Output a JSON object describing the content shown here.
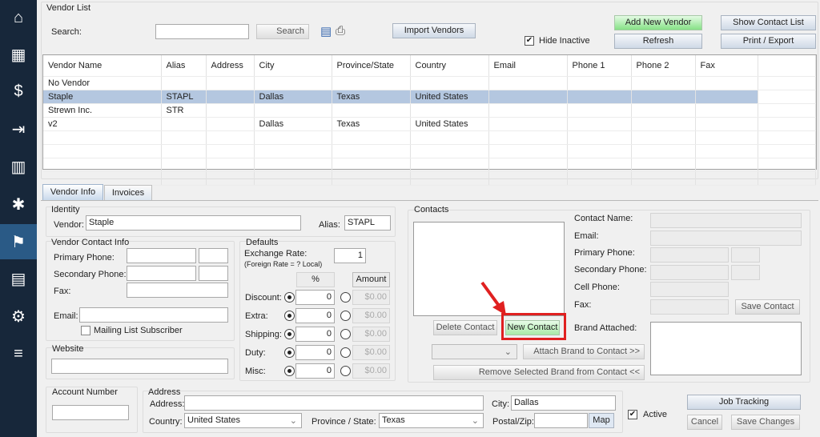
{
  "sidebar": {
    "items": [
      {
        "name": "home",
        "icon": "⌂"
      },
      {
        "name": "register",
        "icon": "▦"
      },
      {
        "name": "invoice",
        "icon": "$"
      },
      {
        "name": "logout",
        "icon": "⇥"
      },
      {
        "name": "buildings",
        "icon": "▥"
      },
      {
        "name": "person-walk",
        "icon": "✱"
      },
      {
        "name": "vendors",
        "icon": "⚑",
        "active": true
      },
      {
        "name": "reports",
        "icon": "▤"
      },
      {
        "name": "settings",
        "icon": "⚙"
      },
      {
        "name": "menu",
        "icon": "≡"
      }
    ]
  },
  "vendor_list": {
    "title": "Vendor List",
    "search_label": "Search:",
    "search_value": "",
    "search_button": "Search",
    "import_button": "Import Vendors",
    "hide_inactive_label": "Hide Inactive",
    "hide_inactive": true,
    "add_new_vendor": "Add New Vendor",
    "refresh": "Refresh",
    "show_contact_list": "Show Contact List",
    "print_export": "Print / Export",
    "columns": [
      "Vendor Name",
      "Alias",
      "Address",
      "City",
      "Province/State",
      "Country",
      "Email",
      "Phone 1",
      "Phone 2",
      "Fax"
    ],
    "rows": [
      [
        "No Vendor",
        "",
        "",
        "",
        "",
        "",
        "",
        "",
        "",
        ""
      ],
      [
        "Staple",
        "STAPL",
        "",
        "Dallas",
        "Texas",
        "United States",
        "",
        "",
        "",
        ""
      ],
      [
        "Strewn Inc.",
        "STR",
        "",
        "",
        "",
        "",
        "",
        "",
        "",
        ""
      ],
      [
        "v2",
        "",
        "",
        "Dallas",
        "Texas",
        "United States",
        "",
        "",
        "",
        ""
      ]
    ],
    "selected_row": 1
  },
  "tabs": [
    {
      "label": "Vendor Info",
      "active": true
    },
    {
      "label": "Invoices"
    }
  ],
  "identity": {
    "title": "Identity",
    "vendor_label": "Vendor:",
    "vendor_value": "Staple",
    "alias_label": "Alias:",
    "alias_value": "STAPL"
  },
  "contact_info": {
    "title": "Vendor Contact Info",
    "primary_phone": "Primary Phone:",
    "secondary_phone": "Secondary Phone:",
    "fax": "Fax:",
    "email": "Email:",
    "mailing_list": "Mailing List Subscriber"
  },
  "website": {
    "title": "Website",
    "value": ""
  },
  "defaults": {
    "title": "Defaults",
    "exchange_rate_label": "Exchange Rate:",
    "exchange_note": "(Foreign  Rate = ? Local)",
    "exchange_rate": "1",
    "pct_header": "%",
    "amount_header": "Amount",
    "rows": [
      {
        "label": "Discount:",
        "pct": "0",
        "amount": "$0.00"
      },
      {
        "label": "Extra:",
        "pct": "0",
        "amount": "$0.00"
      },
      {
        "label": "Shipping:",
        "pct": "0",
        "amount": "$0.00"
      },
      {
        "label": "Duty:",
        "pct": "0",
        "amount": "$0.00"
      },
      {
        "label": "Misc:",
        "pct": "0",
        "amount": "$0.00"
      }
    ]
  },
  "contacts": {
    "title": "Contacts",
    "delete_contact": "Delete Contact",
    "new_contact": "New Contact",
    "attach_brand": "Attach Brand to Contact >>",
    "remove_brand": "Remove Selected Brand from Contact <<",
    "contact_name": "Contact Name:",
    "email": "Email:",
    "primary_phone": "Primary Phone:",
    "secondary_phone": "Secondary Phone:",
    "cell_phone": "Cell Phone:",
    "fax": "Fax:",
    "save_contact": "Save Contact",
    "brand_attached": "Brand Attached:"
  },
  "account": {
    "title": "Account Number",
    "value": ""
  },
  "address": {
    "title": "Address",
    "address_label": "Address:",
    "address_value": "",
    "city_label": "City:",
    "city_value": "Dallas",
    "country_label": "Country:",
    "country_value": "United States",
    "state_label": "Province / State:",
    "state_value": "Texas",
    "zip_label": "Postal/Zip:",
    "zip_value": "",
    "map_button": "Map"
  },
  "footer": {
    "active_label": "Active",
    "active": true,
    "job_tracking": "Job Tracking",
    "cancel": "Cancel",
    "save_changes": "Save Changes"
  },
  "colors": {
    "sidebar": "#17273a",
    "selection": "#b4c7e0",
    "highlight": "#e02020"
  }
}
